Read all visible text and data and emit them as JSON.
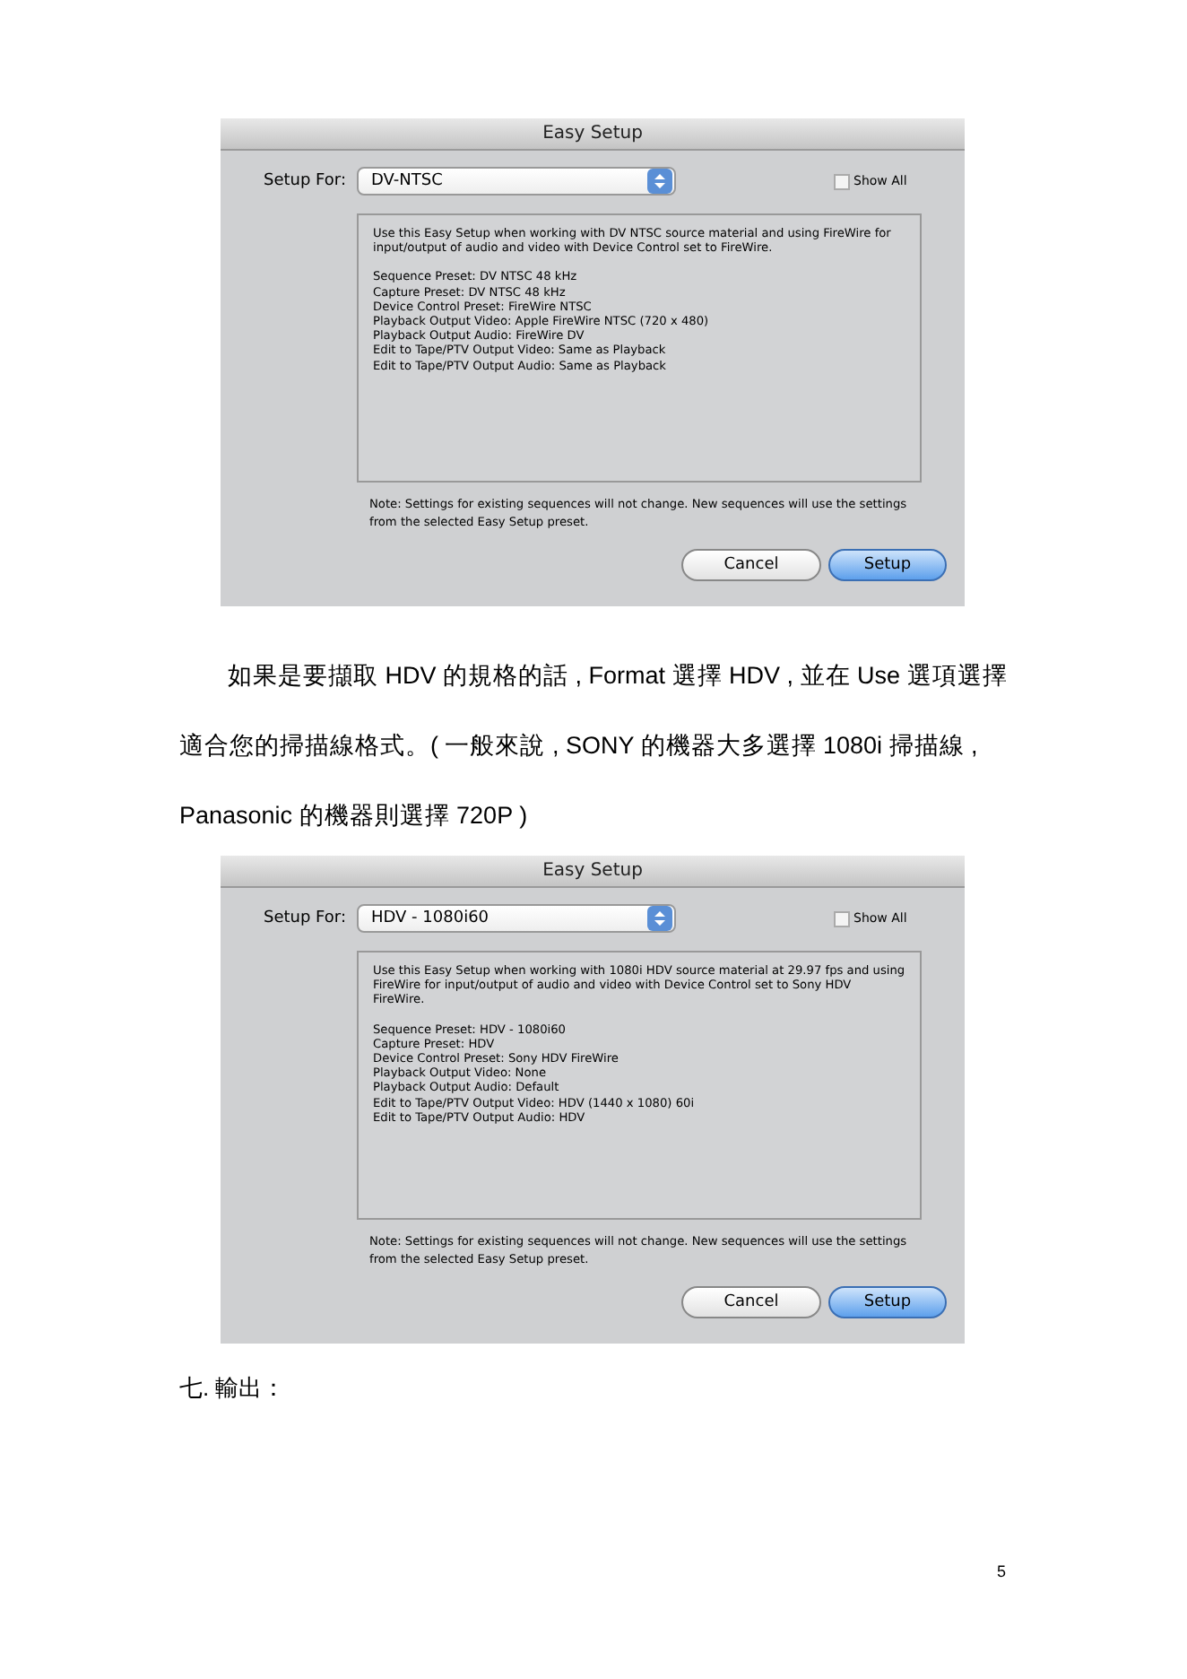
{
  "blocks": [
    {
      "kind": "dialog",
      "title": "Easy Setup",
      "setup_label": "Setup For:",
      "preset": "DV-NTSC",
      "show_all": {
        "label": "Show All",
        "checked": false
      },
      "intro": "Use this Easy Setup when working with DV NTSC source material and using FireWire for input/output of audio and video with Device Control set to FireWire.",
      "settings": [
        "Sequence Preset: DV NTSC 48 kHz",
        "Capture Preset: DV NTSC 48 kHz",
        "Device Control Preset: FireWire NTSC",
        "Playback Output Video: Apple FireWire NTSC (720 x 480)",
        "Playback Output Audio: FireWire DV",
        "Edit to Tape/PTV Output Video: Same as Playback",
        "Edit to Tape/PTV Output Audio: Same as Playback"
      ],
      "note": "Note: Settings for existing sequences will not change. New sequences will use the settings from the selected Easy Setup preset.",
      "buttons": [
        {
          "label": "Cancel",
          "default": false
        },
        {
          "label": "Setup",
          "default": true
        }
      ]
    },
    {
      "kind": "paragraph",
      "lines": [
        "如果是要擷取 HDV 的規格的話 , Format 選擇 HDV , 並在 Use 選項選擇",
        "適合您的掃描線格式。( 一般來說 , SONY 的機器大多選擇 1080i 掃描線 ,",
        "Panasonic 的機器則選擇 720P )"
      ]
    },
    {
      "kind": "dialog",
      "title": "Easy Setup",
      "setup_label": "Setup For:",
      "preset": "HDV - 1080i60",
      "show_all": {
        "label": "Show All",
        "checked": false
      },
      "intro": "Use this Easy Setup when working with 1080i HDV source material at 29.97 fps and using FireWire for input/output of audio and video with Device Control set to Sony HDV FireWire.",
      "settings": [
        "Sequence Preset: HDV - 1080i60",
        "Capture Preset: HDV",
        "Device Control Preset: Sony HDV FireWire",
        "Playback Output Video: None",
        "Playback Output Audio: Default",
        "Edit to Tape/PTV Output Video: HDV (1440 x 1080) 60i",
        "Edit to Tape/PTV Output Audio: HDV"
      ],
      "note": "Note: Settings for existing sequences will not change. New sequences will use the settings from the selected Easy Setup preset.",
      "buttons": [
        {
          "label": "Cancel",
          "default": false
        },
        {
          "label": "Setup",
          "default": true
        }
      ]
    },
    {
      "kind": "heading",
      "text": "七.  輸出："
    }
  ],
  "page_number": "5"
}
